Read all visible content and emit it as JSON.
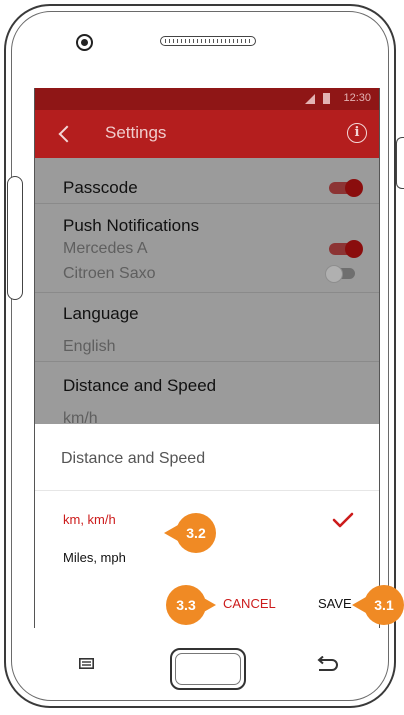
{
  "status_bar": {
    "time": "12:30"
  },
  "app_bar": {
    "title": "Settings"
  },
  "settings": {
    "passcode_label": "Passcode",
    "push_header": "Push Notifications",
    "cars": [
      {
        "label": "Mercedes A",
        "enabled": true
      },
      {
        "label": "Citroen Saxo",
        "enabled": false
      }
    ],
    "passcode_enabled": true,
    "language_label": "Language",
    "language_value": "English",
    "distance_label": "Distance and Speed",
    "distance_value": "km/h"
  },
  "dialog": {
    "title": "Distance and Speed",
    "options": [
      {
        "label": "km, km/h",
        "selected": true
      },
      {
        "label": "Miles, mph",
        "selected": false
      }
    ],
    "cancel_label": "CANCEL",
    "save_label": "SAVE"
  },
  "annotations": {
    "save": "3.1",
    "option": "3.2",
    "cancel": "3.3"
  },
  "colors": {
    "accent": "#cc1b1b",
    "app_bar": "#b41e1e",
    "status_bar": "#8f1616",
    "badge": "#f08a24"
  }
}
